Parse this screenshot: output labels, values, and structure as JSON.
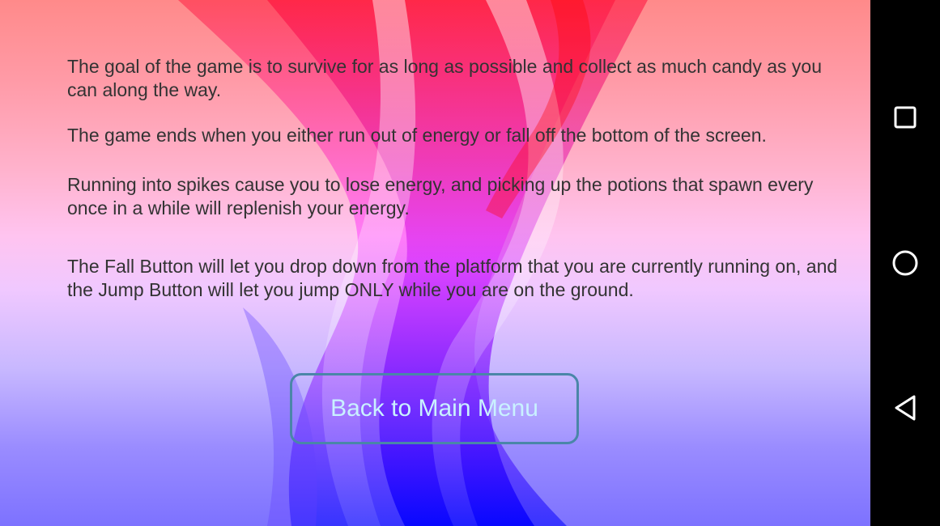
{
  "instructions": {
    "paragraphs": [
      "The goal of the game is to survive for as long as possible and collect as much candy as you can along the way.",
      "The game ends when you either run out of energy or fall off the bottom of the screen.",
      "Running into spikes cause you to lose energy, and picking up the potions that spawn every once in a while will replenish your energy.",
      "The Fall Button will let you drop down from the platform that you are currently running on, and the Jump Button will let you jump ONLY while you are on the ground."
    ]
  },
  "back_button": {
    "label": "Back to Main Menu"
  },
  "colors": {
    "text": "#333333",
    "button_border": "#4a86a8",
    "button_text": "#c9f1ff",
    "background_top": "#ff8a8a",
    "background_bottom": "#7d72ff"
  },
  "navigation_bar": {
    "recents_icon": "square-icon",
    "home_icon": "circle-icon",
    "back_icon": "triangle-back-icon"
  }
}
